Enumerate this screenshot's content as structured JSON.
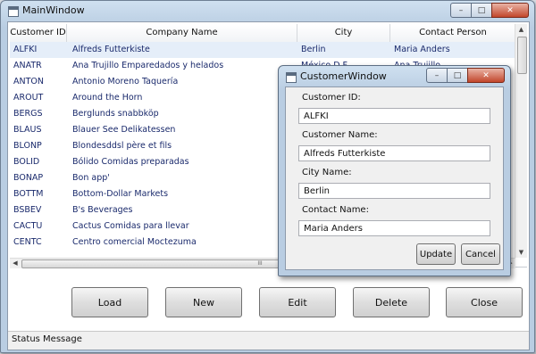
{
  "main_window": {
    "title": "MainWindow",
    "columns": [
      "Customer ID",
      "Company Name",
      "City",
      "Contact Person"
    ],
    "rows": [
      [
        "ALFKI",
        "Alfreds Futterkiste",
        "Berlin",
        "Maria Anders"
      ],
      [
        "ANATR",
        "Ana Trujillo Emparedados y helados",
        "México D.F.",
        "Ana Trujillo"
      ],
      [
        "ANTON",
        "Antonio Moreno Taquería",
        "",
        ""
      ],
      [
        "AROUT",
        "Around the Horn",
        "",
        ""
      ],
      [
        "BERGS",
        "Berglunds snabbköp",
        "",
        ""
      ],
      [
        "BLAUS",
        "Blauer See Delikatessen",
        "",
        ""
      ],
      [
        "BLONP",
        "Blondesddsl père et fils",
        "",
        ""
      ],
      [
        "BOLID",
        "Bólido Comidas preparadas",
        "",
        ""
      ],
      [
        "BONAP",
        "Bon app'",
        "",
        ""
      ],
      [
        "BOTTM",
        "Bottom-Dollar Markets",
        "",
        ""
      ],
      [
        "BSBEV",
        "B's Beverages",
        "",
        ""
      ],
      [
        "CACTU",
        "Cactus Comidas para llevar",
        "",
        ""
      ],
      [
        "CENTC",
        "Centro comercial Moctezuma",
        "",
        ""
      ]
    ],
    "buttons": {
      "load": "Load",
      "new": "New",
      "edit": "Edit",
      "delete": "Delete",
      "close": "Close"
    },
    "status": "Status Message",
    "hscroll_grip": "III"
  },
  "customer_window": {
    "title": "CustomerWindow",
    "customer_id_label": "Customer ID:",
    "customer_id_value": "ALFKI",
    "customer_name_label": "Customer Name:",
    "customer_name_value": "Alfreds Futterkiste",
    "city_name_label": "City Name:",
    "city_name_value": "Berlin",
    "contact_name_label": "Contact Name:",
    "contact_name_value": "Maria Anders",
    "update_label": "Update",
    "cancel_label": "Cancel"
  },
  "caption_glyphs": {
    "minimize": "–",
    "maximize": "□",
    "close": "✕"
  },
  "colors": {
    "grid_text": "#1a2a6c",
    "selected_row": "#e5eef9",
    "title_bar": "#b9cde2"
  }
}
